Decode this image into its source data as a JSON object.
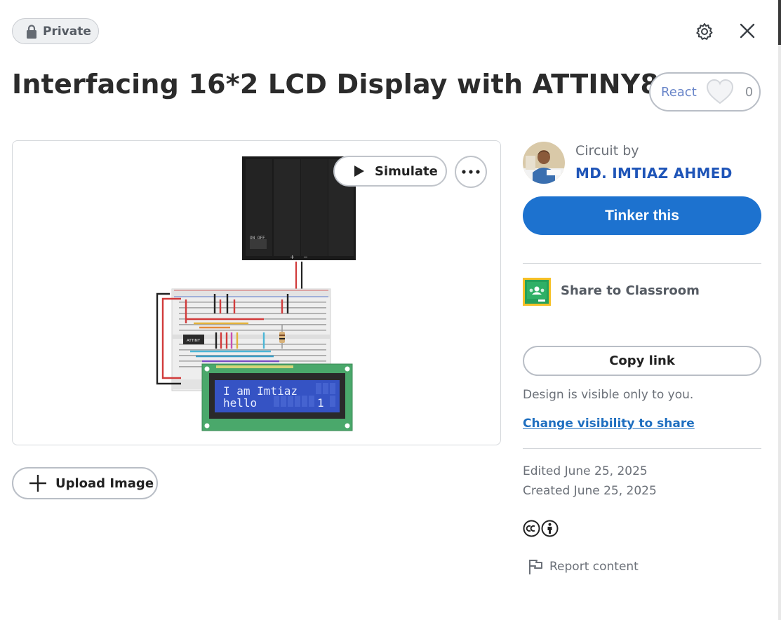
{
  "header": {
    "privacy_badge": "Private",
    "title": "Interfacing 16*2 LCD Display with ATTINY85"
  },
  "reactions": {
    "label": "React",
    "count": "0"
  },
  "preview": {
    "simulate_label": "Simulate",
    "lcd_line1": "I am Imtiaz",
    "lcd_line2": "hello",
    "lcd_line2_right": "1",
    "chip_label": "ATTINY",
    "battery_switch_label": "ON  OFF"
  },
  "upload": {
    "label": "Upload Image"
  },
  "author": {
    "caption": "Circuit by",
    "name": "MD. IMTIAZ AHMED"
  },
  "actions": {
    "tinker_label": "Tinker this",
    "classroom_label": "Share to Classroom",
    "copy_link_label": "Copy link",
    "visibility_note": "Design is visible only to you.",
    "change_visibility_label": "Change visibility to share"
  },
  "meta": {
    "edited": "Edited June 25, 2025",
    "created": "Created June 25, 2025",
    "report_label": "Report content"
  },
  "colors": {
    "primary": "#1d72cf",
    "link": "#1f55b8",
    "lcd_blue": "#3553c4",
    "pcb_green": "#4aa86b",
    "classroom_green": "#25a05a",
    "classroom_yellow": "#f6c026"
  },
  "icons": [
    "lock-icon",
    "gear-icon",
    "close-icon",
    "heart-icon",
    "play-icon",
    "more-icon",
    "plus-icon",
    "classroom-icon",
    "cc-icon",
    "by-icon",
    "flag-icon"
  ]
}
